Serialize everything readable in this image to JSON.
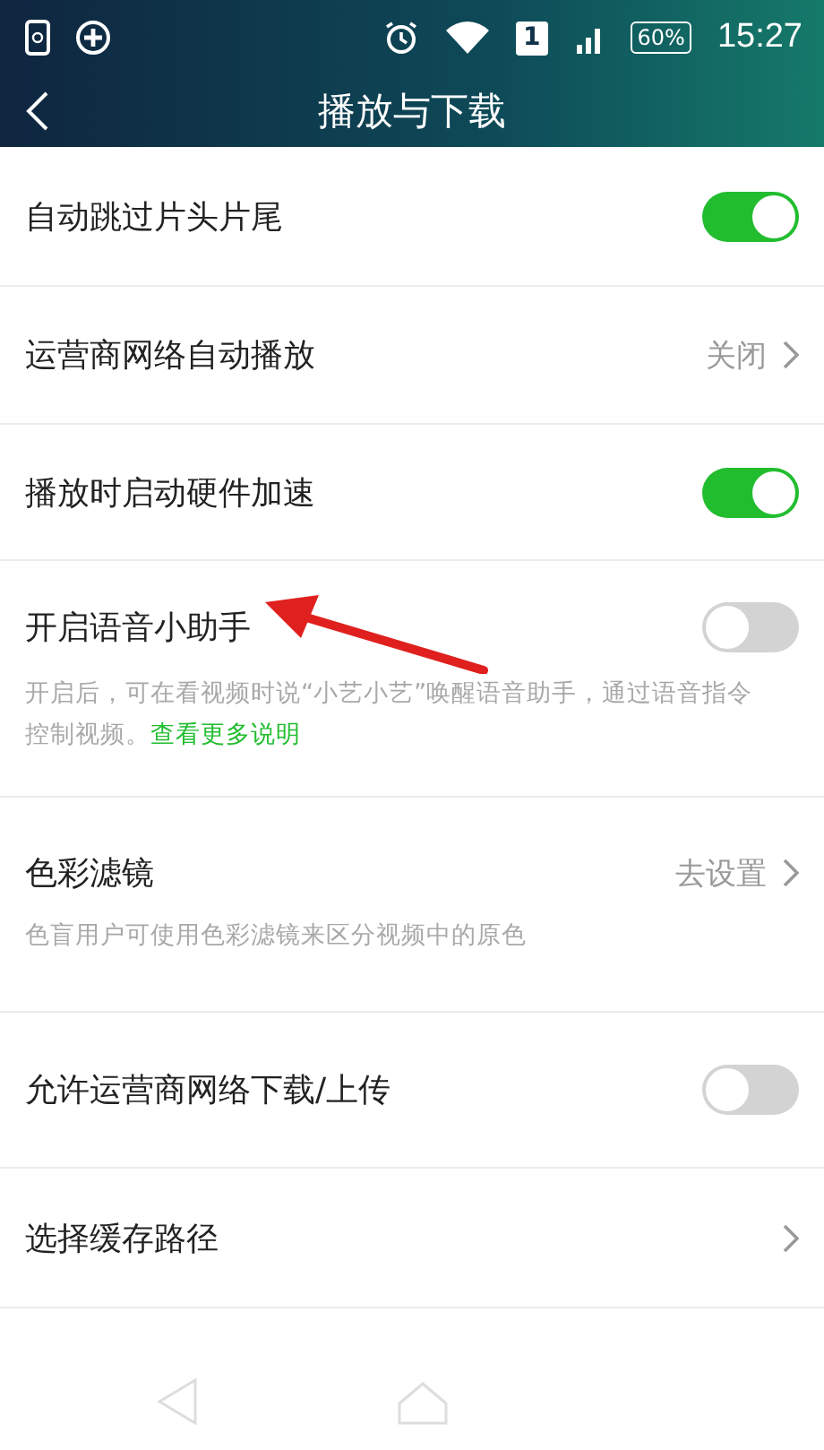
{
  "status_bar": {
    "sim": "1",
    "battery": "60%",
    "time": "15:27"
  },
  "title_bar": {
    "title": "播放与下载"
  },
  "settings": [
    {
      "kind": "toggle",
      "label": "自动跳过片头片尾",
      "on": true
    },
    {
      "kind": "link",
      "label": "运营商网络自动播放",
      "value": "关闭"
    },
    {
      "kind": "toggle",
      "label": "播放时启动硬件加速",
      "on": true
    },
    {
      "kind": "toggle",
      "label": "开启语音小助手",
      "on": false,
      "description": "开启后，可在看视频时说“小艺小艺”唤醒语音助手，通过语音指令控制视频。",
      "link": "查看更多说明"
    },
    {
      "kind": "link",
      "label": "色彩滤镜",
      "value": "去设置",
      "description": "色盲用户可使用色彩滤镜来区分视频中的原色"
    },
    {
      "kind": "toggle",
      "label": "允许运营商网络下载/上传",
      "on": false
    },
    {
      "kind": "link",
      "label": "选择缓存路径"
    }
  ]
}
